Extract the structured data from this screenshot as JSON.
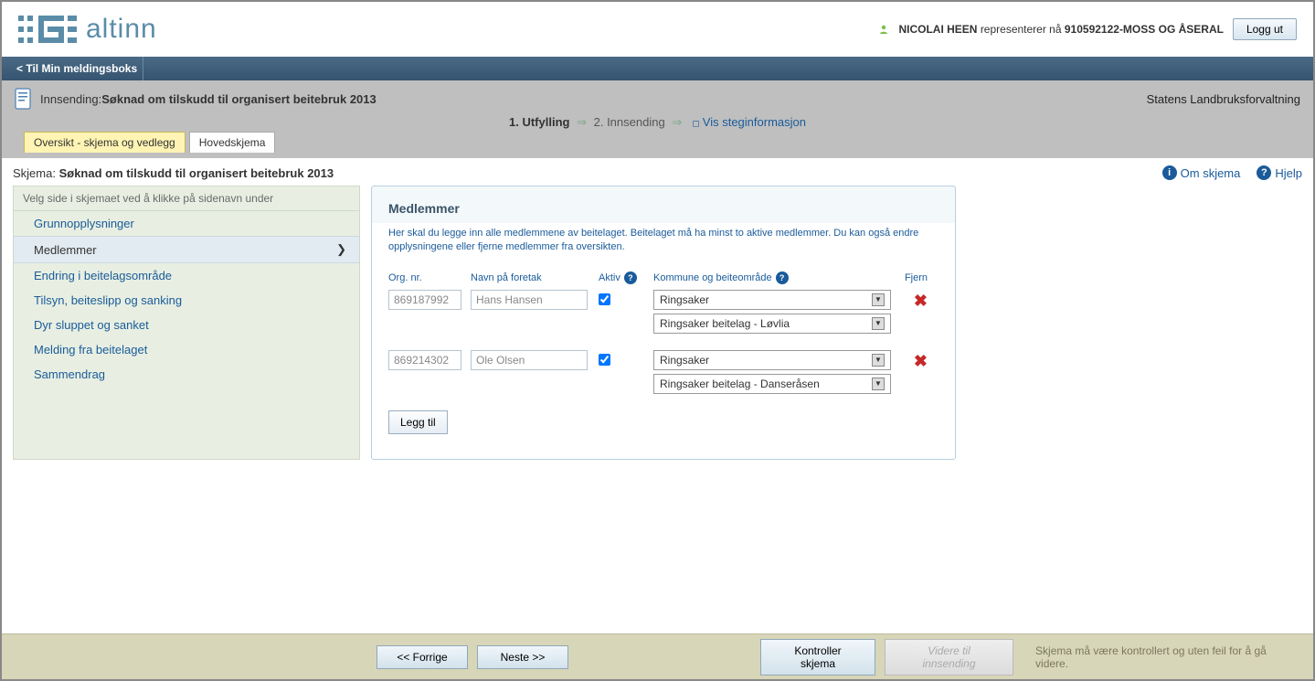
{
  "header": {
    "logo_text": "altinn",
    "user_name": "NICOLAI HEEN",
    "represents_text": "representerer nå",
    "org_text": "910592122-MOSS OG ÅSERAL",
    "logout": "Logg ut"
  },
  "navbar": {
    "back_link": "< Til Min meldingsboks"
  },
  "graybar": {
    "innsending_label": "Innsending:",
    "innsending_title": "Søknad om tilskudd til organisert beitebruk 2013",
    "right_org": "Statens Landbruksforvaltning",
    "step1": "1.  Utfylling",
    "step2": "2.  Innsending",
    "steginfo": "Vis steginformasjon"
  },
  "tabs": {
    "oversikt": "Oversikt - skjema og vedlegg",
    "hoved": "Hovedskjema"
  },
  "skjema_line": {
    "label": "Skjema:",
    "title": "Søknad om tilskudd til organisert beitebruk 2013",
    "om_skjema": "Om skjema",
    "hjelp": "Hjelp"
  },
  "sidebar": {
    "head": "Velg side i skjemaet ved å klikke på sidenavn under",
    "items": [
      {
        "label": "Grunnopplysninger"
      },
      {
        "label": "Medlemmer"
      },
      {
        "label": "Endring i beitelagsområde"
      },
      {
        "label": "Tilsyn, beiteslipp og sanking"
      },
      {
        "label": "Dyr sluppet og sanket"
      },
      {
        "label": "Melding fra beitelaget"
      },
      {
        "label": "Sammendrag"
      }
    ]
  },
  "panel": {
    "title": "Medlemmer",
    "desc": "Her skal du legge inn alle medlemmene av beitelaget. Beitelaget må ha minst to aktive medlemmer. Du kan også endre opplysningene eller fjerne medlemmer fra oversikten.",
    "headers": {
      "orgnr": "Org. nr.",
      "navn": "Navn på foretak",
      "aktiv": "Aktiv",
      "komm": "Kommune og beiteområde",
      "fjern": "Fjern"
    },
    "members": [
      {
        "orgnr": "869187992",
        "navn": "Hans Hansen",
        "aktiv": true,
        "kommune": "Ringsaker",
        "beite": "Ringsaker beitelag - Løvlia"
      },
      {
        "orgnr": "869214302",
        "navn": "Ole Olsen",
        "aktiv": true,
        "kommune": "Ringsaker",
        "beite": "Ringsaker beitelag - Danseråsen"
      }
    ],
    "add_btn": "Legg til"
  },
  "footer": {
    "prev": "<< Forrige",
    "next": "Neste >>",
    "kontroll": "Kontroller skjema",
    "videre": "Videre til innsending",
    "msg": "Skjema må være kontrollert og uten feil for å gå videre."
  }
}
